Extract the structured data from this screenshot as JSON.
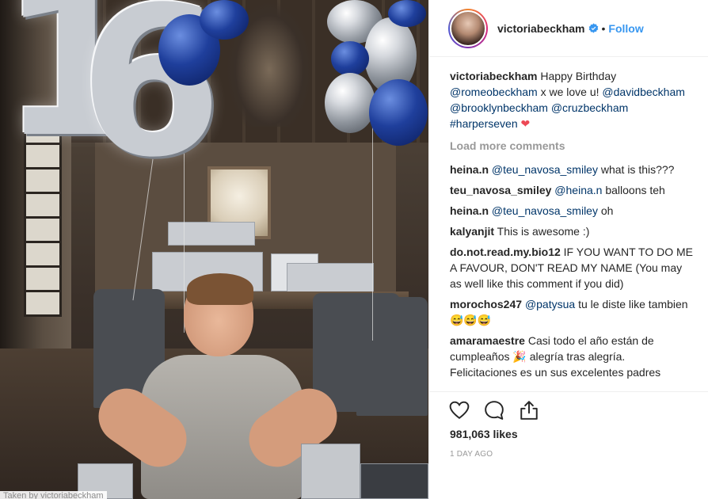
{
  "photo": {
    "digit_one": "1",
    "digit_six": "6",
    "tagged_label": "Taken by victoriabeckham"
  },
  "header": {
    "username": "victoriabeckham",
    "separator": "•",
    "follow_label": "Follow"
  },
  "caption": {
    "user": "victoriabeckham",
    "text_1": " Happy Birthday ",
    "mention_1": "@romeobeckham",
    "text_2": " x we love u! ",
    "mention_2": "@davidbeckham",
    "text_3": " ",
    "mention_3": "@brooklynbeckham",
    "text_4": " ",
    "mention_4": "@cruzbeckham",
    "text_5": " ",
    "mention_5": "#harperseven",
    "emoji": "❤"
  },
  "load_more_label": "Load more comments",
  "comments": [
    {
      "user": "heina.n",
      "mention": "@teu_navosa_smiley",
      "text": " what is this???"
    },
    {
      "user": "teu_navosa_smiley",
      "mention": "@heina.n",
      "text": " balloons teh"
    },
    {
      "user": "heina.n",
      "mention": "@teu_navosa_smiley",
      "text": " oh"
    },
    {
      "user": "kalyanjit",
      "mention": "",
      "text": " This is awesome :)"
    },
    {
      "user": "do.not.read.my.bio12",
      "mention": "",
      "text": " IF YOU WANT TO DO ME A FAVOUR, DON'T READ MY NAME (You may as well like this comment if you did)"
    },
    {
      "user": "morochos247",
      "mention": "@patysua",
      "text": " tu le diste like tambien 😅😅😅"
    },
    {
      "user": "amaramaestre",
      "mention": "",
      "text": " Casi todo el año están de cumpleaños 🎉 alegría tras alegría. Felicitaciones es un sus excelentes padres"
    }
  ],
  "actions": {
    "like_icon": "heart-icon",
    "comment_icon": "comment-bubble-icon",
    "share_icon": "share-icon"
  },
  "likes_label": "981,063 likes",
  "timestamp_label": "1 DAY AGO",
  "colors": {
    "follow": "#3897f0",
    "mention": "#003569",
    "muted": "#999999",
    "text": "#262626",
    "heart": "#ed4956"
  }
}
